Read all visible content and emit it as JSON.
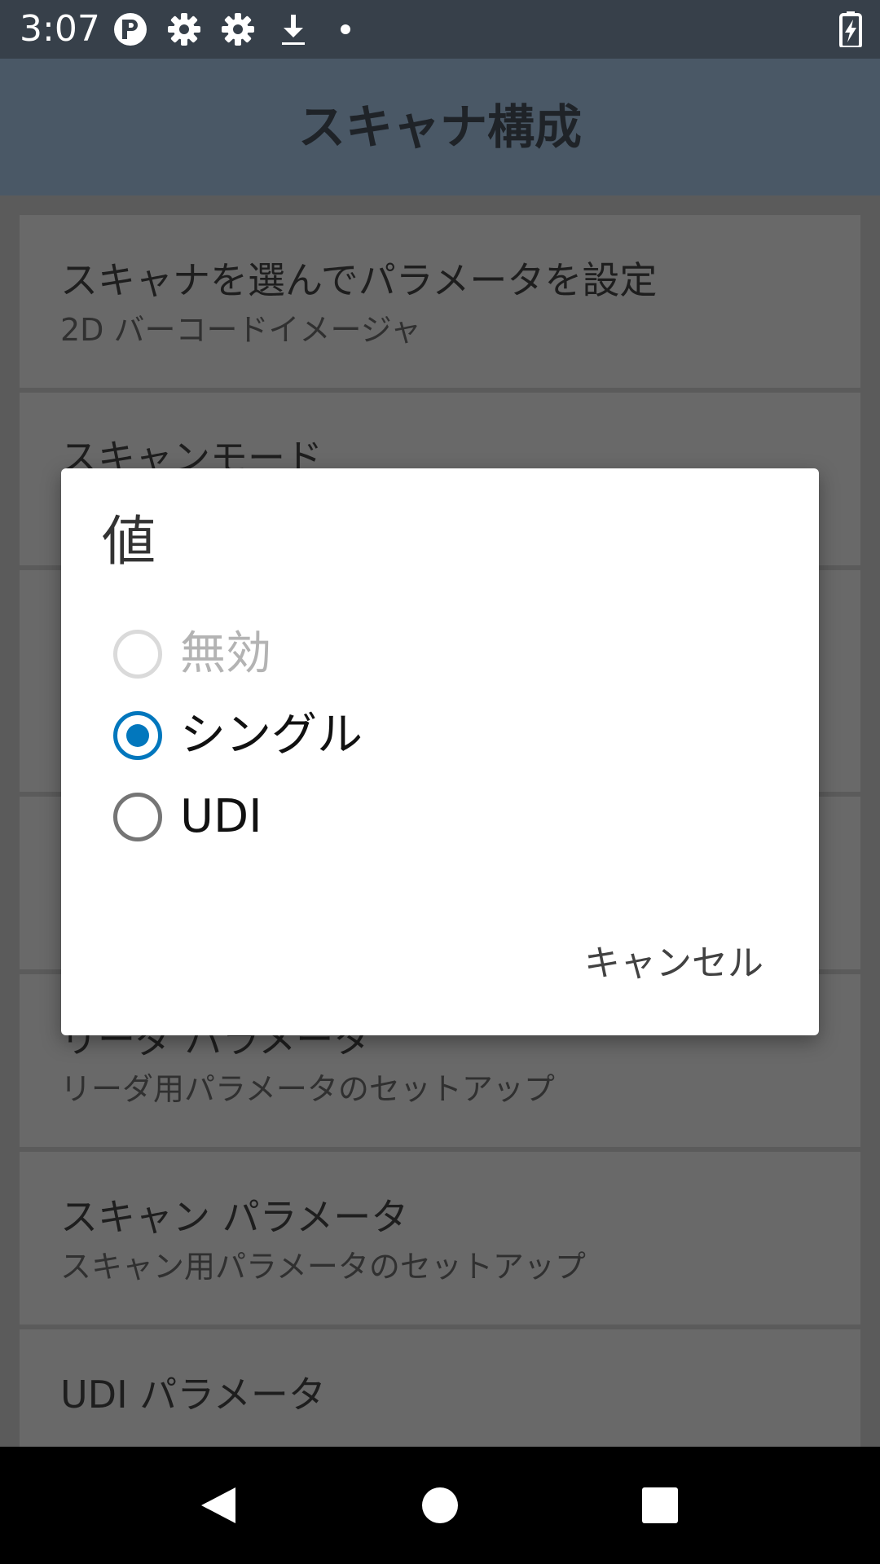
{
  "status_bar": {
    "time": "3:07",
    "icons": [
      "app-logo-icon",
      "gear-icon",
      "gear-icon",
      "download-icon",
      "dot-icon",
      "battery-charging-icon"
    ]
  },
  "app_bar": {
    "title": "スキャナ構成"
  },
  "list": {
    "items": [
      {
        "title": "スキャナを選んでパラメータを設定",
        "subtitle": "2D バーコードイメージャ"
      },
      {
        "title": "スキャンモード",
        "subtitle": ""
      },
      {
        "title": "",
        "subtitle": ""
      },
      {
        "title": "",
        "subtitle": ""
      },
      {
        "title": "リーダ パラメータ",
        "subtitle": "リーダ用パラメータのセットアップ"
      },
      {
        "title": "スキャン パラメータ",
        "subtitle": "スキャン用パラメータのセットアップ"
      },
      {
        "title": "UDI パラメータ",
        "subtitle": ""
      }
    ]
  },
  "dialog": {
    "title": "値",
    "options": [
      {
        "label": "無効",
        "state": "disabled"
      },
      {
        "label": "シングル",
        "state": "selected"
      },
      {
        "label": "UDI",
        "state": "unselected"
      }
    ],
    "cancel_label": "キャンセル"
  },
  "colors": {
    "accent": "#0277bd",
    "status_bar": "#37404a",
    "app_bar": "#4a5866",
    "dialog_bg": "#ffffff"
  },
  "nav_bar": {
    "buttons": [
      "back-icon",
      "home-icon",
      "recents-icon"
    ]
  }
}
